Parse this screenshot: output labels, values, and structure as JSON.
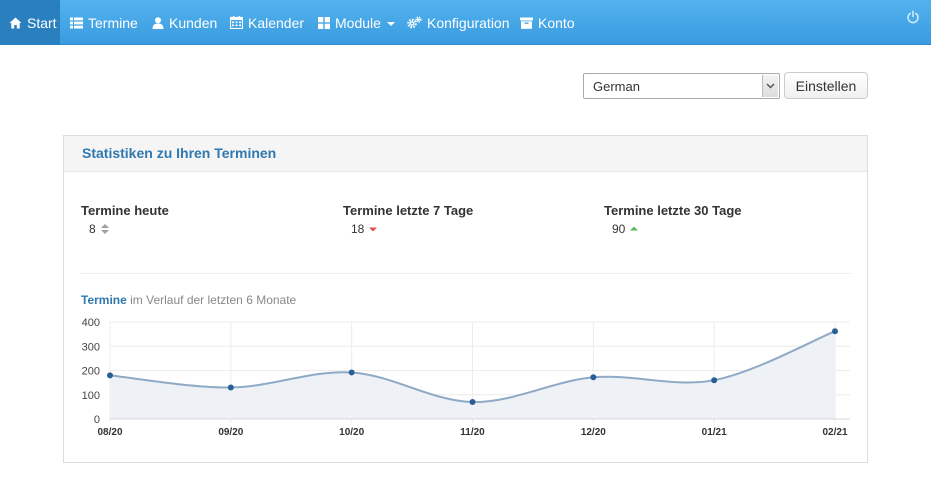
{
  "nav": {
    "items": [
      {
        "label": "Start",
        "icon": "home-icon"
      },
      {
        "label": "Termine",
        "icon": "list-icon"
      },
      {
        "label": "Kunden",
        "icon": "user-icon"
      },
      {
        "label": "Kalender",
        "icon": "calendar-icon"
      },
      {
        "label": "Module",
        "icon": "grid-icon"
      },
      {
        "label": "Konfiguration",
        "icon": "cogs-icon"
      },
      {
        "label": "Konto",
        "icon": "archive-icon"
      }
    ],
    "power_icon": "power-icon"
  },
  "language": {
    "selected": "German",
    "button_label": "Einstellen"
  },
  "panel": {
    "title": "Statistiken zu Ihren Terminen",
    "stats": [
      {
        "label": "Termine heute",
        "value": "8",
        "trend": "neutral",
        "trend_color": "#999999"
      },
      {
        "label": "Termine letzte 7 Tage",
        "value": "18",
        "trend": "down",
        "trend_color": "#d9534f"
      },
      {
        "label": "Termine letzte 30 Tage",
        "value": "90",
        "trend": "up",
        "trend_color": "#5cb85c"
      }
    ],
    "chart_title_strong": "Termine",
    "chart_title_rest": " im Verlauf der letzten 6 Monate"
  },
  "colors": {
    "navbar": "#4aa8ea",
    "accent": "#2f78b0",
    "line": "#8eaac6",
    "area": "#eef1f6",
    "point": "#2a5f96"
  },
  "chart_data": {
    "type": "area",
    "x": [
      "08/20",
      "09/20",
      "10/20",
      "11/20",
      "12/20",
      "01/21",
      "02/21"
    ],
    "values": [
      180,
      130,
      192,
      70,
      172,
      160,
      362
    ],
    "yticks": [
      0,
      100,
      200,
      300,
      400
    ],
    "ylim": [
      0,
      400
    ],
    "grid": true
  }
}
